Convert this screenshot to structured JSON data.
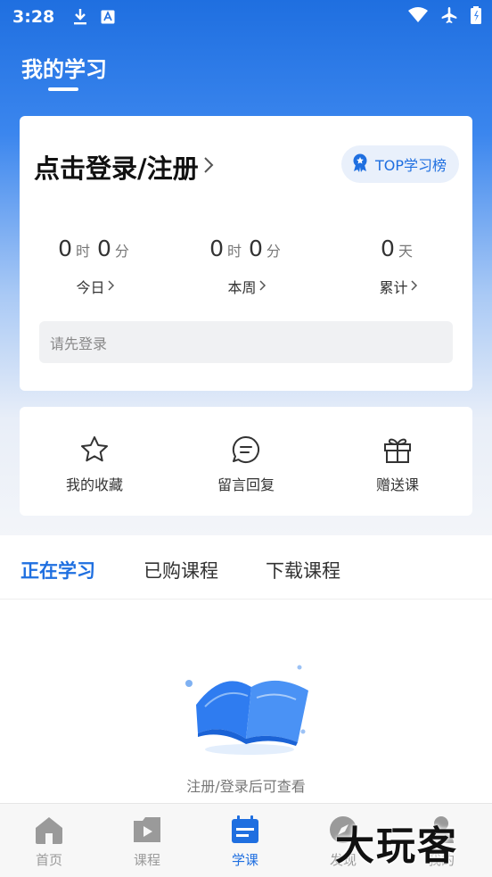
{
  "status_bar": {
    "time": "3:28"
  },
  "header": {
    "title": "我的学习"
  },
  "login_card": {
    "login_link": "点击登录/注册",
    "top_button": "TOP学习榜",
    "stats": [
      {
        "hours": "0",
        "hour_unit": "时",
        "minutes": "0",
        "minute_unit": "分",
        "label": "今日"
      },
      {
        "hours": "0",
        "hour_unit": "时",
        "minutes": "0",
        "minute_unit": "分",
        "label": "本周"
      },
      {
        "days": "0",
        "day_unit": "天",
        "label": "累计"
      }
    ],
    "notice": "请先登录"
  },
  "quick_actions": [
    {
      "label": "我的收藏",
      "icon": "star-icon"
    },
    {
      "label": "留言回复",
      "icon": "chat-icon"
    },
    {
      "label": "赠送课",
      "icon": "gift-icon"
    }
  ],
  "tabs": [
    {
      "label": "正在学习",
      "active": true
    },
    {
      "label": "已购课程",
      "active": false
    },
    {
      "label": "下载课程",
      "active": false
    }
  ],
  "empty_state": {
    "text": "注册/登录后可查看",
    "icon": "open-book-icon"
  },
  "bottom_nav": [
    {
      "label": "首页",
      "icon": "home-icon",
      "active": false
    },
    {
      "label": "课程",
      "icon": "play-icon",
      "active": false
    },
    {
      "label": "学课",
      "icon": "calendar-list-icon",
      "active": true
    },
    {
      "label": "发现",
      "icon": "discover-icon",
      "active": false
    },
    {
      "label": "我的",
      "icon": "person-icon",
      "active": false
    }
  ],
  "watermark": "大玩客",
  "colors": {
    "accent": "#1f6fe0",
    "inactive": "#9a9a9a"
  }
}
